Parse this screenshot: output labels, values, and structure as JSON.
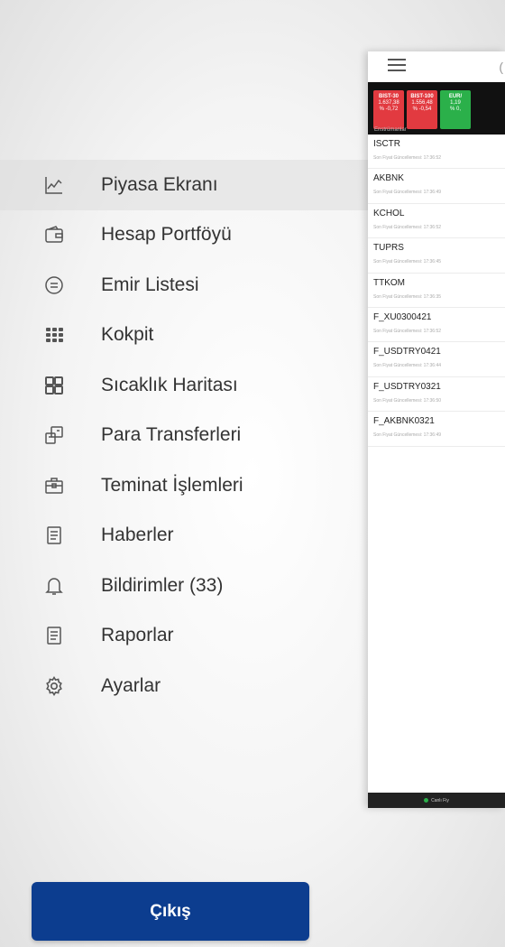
{
  "menu": {
    "items": [
      {
        "label": "Piyasa Ekranı",
        "icon": "chart-line-icon",
        "active": true
      },
      {
        "label": "Hesap Portföyü",
        "icon": "wallet-icon"
      },
      {
        "label": "Emir Listesi",
        "icon": "message-circle-icon"
      },
      {
        "label": "Kokpit",
        "icon": "grid-dots-icon"
      },
      {
        "label": "Sıcaklık Haritası",
        "icon": "heatmap-grid-icon"
      },
      {
        "label": "Para Transferleri",
        "icon": "transfer-icon"
      },
      {
        "label": "Teminat İşlemleri",
        "icon": "briefcase-icon"
      },
      {
        "label": "Haberler",
        "icon": "document-icon"
      },
      {
        "label": "Bildirimler (33)",
        "icon": "bell-icon"
      },
      {
        "label": "Raporlar",
        "icon": "report-icon"
      },
      {
        "label": "Ayarlar",
        "icon": "gear-icon"
      }
    ],
    "logout_label": "Çıkış"
  },
  "preview": {
    "tickers": [
      {
        "name": "BIST-30",
        "value": "1.637,38",
        "change": "% -0,72",
        "color": "#e23a40"
      },
      {
        "name": "BIST-100",
        "value": "1.556,48",
        "change": "% -0,54",
        "color": "#e23a40"
      },
      {
        "name": "EUR/",
        "value": "1,19",
        "change": "% 0,",
        "color": "#2bb04a"
      }
    ],
    "instruments_label": "Enstrümanlar",
    "rows": [
      {
        "symbol": "ISCTR",
        "updated": "Son Fiyat Güncellemesi: 17:36:52"
      },
      {
        "symbol": "AKBNK",
        "updated": "Son Fiyat Güncellemesi: 17:36:49"
      },
      {
        "symbol": "KCHOL",
        "updated": "Son Fiyat Güncellemesi: 17:36:52"
      },
      {
        "symbol": "TUPRS",
        "updated": "Son Fiyat Güncellemesi: 17:36:45"
      },
      {
        "symbol": "TTKOM",
        "updated": "Son Fiyat Güncellemesi: 17:36:35"
      },
      {
        "symbol": "F_XU0300421",
        "updated": "Son Fiyat Güncellemesi: 17:36:52"
      },
      {
        "symbol": "F_USDTRY0421",
        "updated": "Son Fiyat Güncellemesi: 17:36:44"
      },
      {
        "symbol": "F_USDTRY0321",
        "updated": "Son Fiyat Güncellemesi: 17:36:50"
      },
      {
        "symbol": "F_AKBNK0321",
        "updated": "Son Fiyat Güncellemesi: 17:36:49"
      }
    ],
    "footer_label": "Canlı Fiy"
  }
}
